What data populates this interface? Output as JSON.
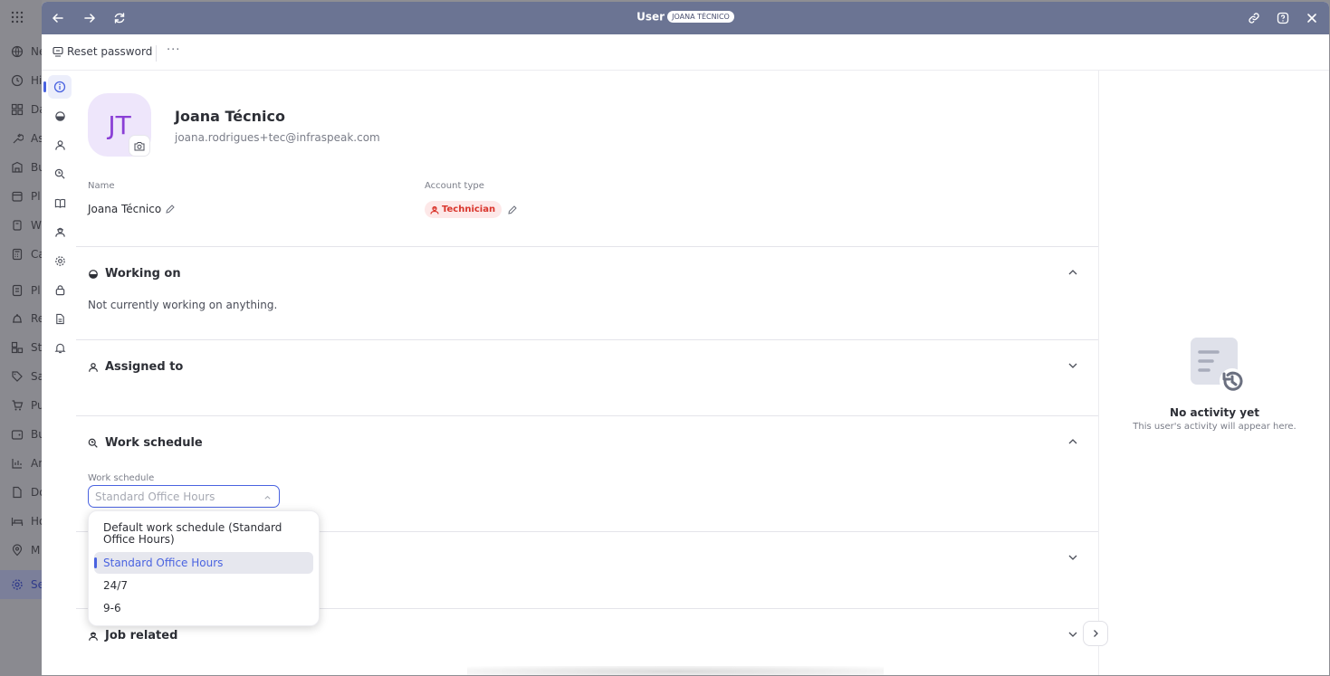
{
  "background_sidebar": {
    "items": [
      {
        "label": "Ne",
        "icon": "globe-icon"
      },
      {
        "label": "Hi",
        "icon": "clock-icon"
      },
      {
        "label": "Da",
        "icon": "grid-icon"
      },
      {
        "label": "As",
        "icon": "wrench-icon"
      },
      {
        "label": "Bu",
        "icon": "building-icon"
      },
      {
        "label": "Pl",
        "icon": "calendar-icon"
      },
      {
        "label": "W",
        "icon": "clipboard-icon"
      },
      {
        "label": "Ca",
        "icon": "calculator-icon"
      },
      {
        "label": "Pl",
        "icon": "document-icon"
      },
      {
        "label": "Re",
        "icon": "bell-icon"
      },
      {
        "label": "St",
        "icon": "boxes-icon"
      },
      {
        "label": "Sa",
        "icon": "tag-icon"
      },
      {
        "label": "Pu",
        "icon": "cart-icon"
      },
      {
        "label": "Bu",
        "icon": "wallet-icon"
      },
      {
        "label": "An",
        "icon": "chart-icon"
      },
      {
        "label": "Do",
        "icon": "file-icon"
      },
      {
        "label": "Ho",
        "icon": "bed-icon"
      },
      {
        "label": "M",
        "icon": "pin-icon"
      },
      {
        "label": "Se",
        "icon": "gear-icon"
      }
    ]
  },
  "titlebar": {
    "title": "User",
    "badge": "JOANA TÉCNICO",
    "bg_color": "#6b7493"
  },
  "toolbar": {
    "reset_label": "Reset password",
    "more_label": "···"
  },
  "user": {
    "initials": "JT",
    "name": "Joana Técnico",
    "email": "joana.rodrigues+tec@infraspeak.com"
  },
  "fields": {
    "name_label": "Name",
    "name_value": "Joana Técnico",
    "account_type_label": "Account type",
    "account_type_value": "Technician",
    "account_color": "#d9342b"
  },
  "sections": {
    "working_on": {
      "title": "Working on",
      "text": "Not currently working on anything."
    },
    "assigned_to": {
      "title": "Assigned to"
    },
    "work_schedule": {
      "title": "Work schedule",
      "field_label": "Work schedule",
      "placeholder": "Standard Office Hours"
    },
    "job_related": {
      "title": "Job related"
    }
  },
  "dropdown": {
    "options": [
      "Default work schedule (Standard Office Hours)",
      "Standard Office Hours",
      "24/7",
      "9-6"
    ],
    "selected": "Standard Office Hours"
  },
  "activity": {
    "title": "No activity yet",
    "subtitle": "This user's activity will appear here."
  },
  "accent_color": "#4a63e0"
}
